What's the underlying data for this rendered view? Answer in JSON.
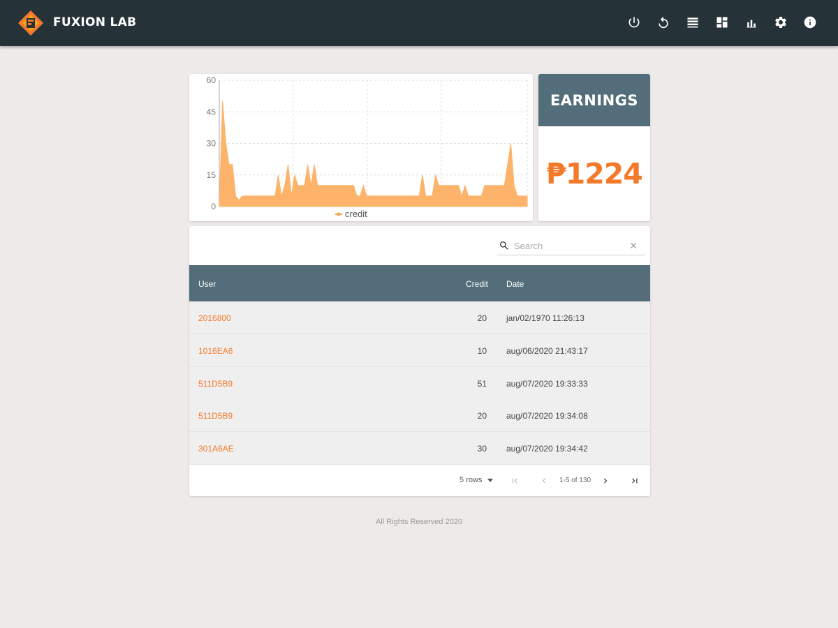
{
  "app": {
    "title": "FUXION LAB",
    "brand_colors": {
      "topbar": "#253238",
      "accent": "#f47a2b",
      "header": "#536e7a",
      "chart_fill": "#fdb36a"
    }
  },
  "toolbar": {
    "icons": [
      "power-icon",
      "refresh-icon",
      "list-icon",
      "dashboard-icon",
      "bar-chart-icon",
      "gear-icon",
      "info-icon"
    ]
  },
  "earnings": {
    "title": "EARNINGS",
    "value": "₱1224"
  },
  "chart_data": {
    "type": "area",
    "series": [
      {
        "name": "credit",
        "values": [
          0,
          50,
          30,
          20,
          20,
          5,
          3,
          5,
          5,
          5,
          5,
          5,
          5,
          5,
          5,
          5,
          5,
          5,
          15,
          5,
          10,
          20,
          5,
          15,
          10,
          10,
          10,
          20,
          10,
          20,
          10,
          10,
          10,
          10,
          10,
          10,
          10,
          10,
          10,
          10,
          10,
          10,
          5,
          5,
          10,
          5,
          5,
          5,
          5,
          5,
          5,
          5,
          5,
          5,
          5,
          5,
          5,
          5,
          5,
          5,
          5,
          5,
          15,
          5,
          5,
          5,
          15,
          10,
          10,
          10,
          10,
          10,
          10,
          10,
          5,
          10,
          5,
          5,
          5,
          5,
          5,
          10,
          10,
          10,
          10,
          10,
          10,
          10,
          20,
          30,
          10,
          5,
          5,
          5,
          5
        ]
      }
    ],
    "ylim": [
      0,
      60
    ],
    "yticks": [
      "0",
      "15",
      "30",
      "45",
      "60"
    ],
    "grid": true,
    "legend": "bottom"
  },
  "search": {
    "placeholder": "Search"
  },
  "table": {
    "headers": {
      "user": "User",
      "credit": "Credit",
      "date": "Date"
    },
    "rows": [
      {
        "user": "2016800",
        "credit": "20",
        "date": "jan/02/1970 11:26:13"
      },
      {
        "user": "1016EA6",
        "credit": "10",
        "date": "aug/06/2020 21:43:17"
      },
      {
        "user": "511D5B9",
        "credit": "51",
        "date": "aug/07/2020 19:33:33"
      },
      {
        "user": "511D5B9",
        "credit": "20",
        "date": "aug/07/2020 19:34:08"
      },
      {
        "user": "301A6AE",
        "credit": "30",
        "date": "aug/07/2020 19:34:42"
      }
    ]
  },
  "pagination": {
    "rows_label": "5 rows",
    "range": "1-5 of 130"
  },
  "footer": {
    "text": "All Rights Reserved 2020"
  }
}
